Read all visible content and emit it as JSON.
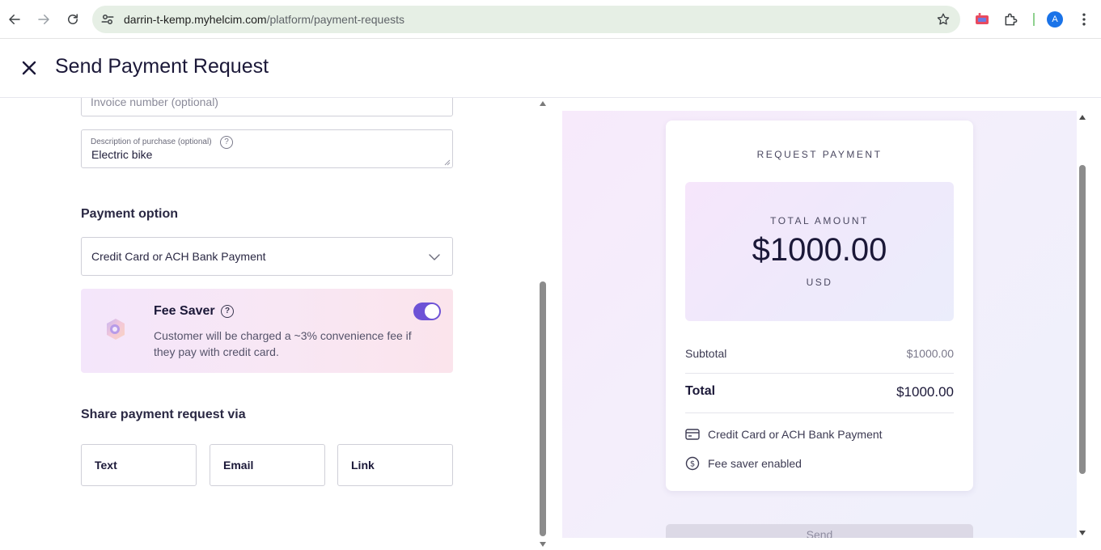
{
  "browser": {
    "url_host": "darrin-t-kemp.myhelcim.com",
    "url_path": "/platform/payment-requests",
    "profile_initial": "A"
  },
  "header": {
    "title": "Send Payment Request"
  },
  "form": {
    "invoice_placeholder": "Invoice number (optional)",
    "description_label": "Description of purchase (optional)",
    "description_value": "Electric bike",
    "help_glyph": "?",
    "payment_option_title": "Payment option",
    "payment_option_value": "Credit Card or ACH Bank Payment",
    "fee_saver": {
      "title": "Fee Saver",
      "description": "Customer will be charged a ~3% convenience fee if they pay with credit card.",
      "enabled": true
    },
    "share_title": "Share payment request via",
    "share_options": [
      "Text",
      "Email",
      "Link"
    ]
  },
  "preview": {
    "request_title": "REQUEST PAYMENT",
    "total_amount_label": "TOTAL AMOUNT",
    "total_amount": "$1000.00",
    "currency": "USD",
    "subtotal_label": "Subtotal",
    "subtotal_value": "$1000.00",
    "total_label": "Total",
    "total_value": "$1000.00",
    "payment_method": "Credit Card or ACH Bank Payment",
    "fee_saver_status": "Fee saver enabled",
    "send_label": "Send"
  },
  "colors": {
    "accent": "#6d52d6",
    "title_text": "#1b1838",
    "omnibox_bg": "#e6efe5"
  }
}
